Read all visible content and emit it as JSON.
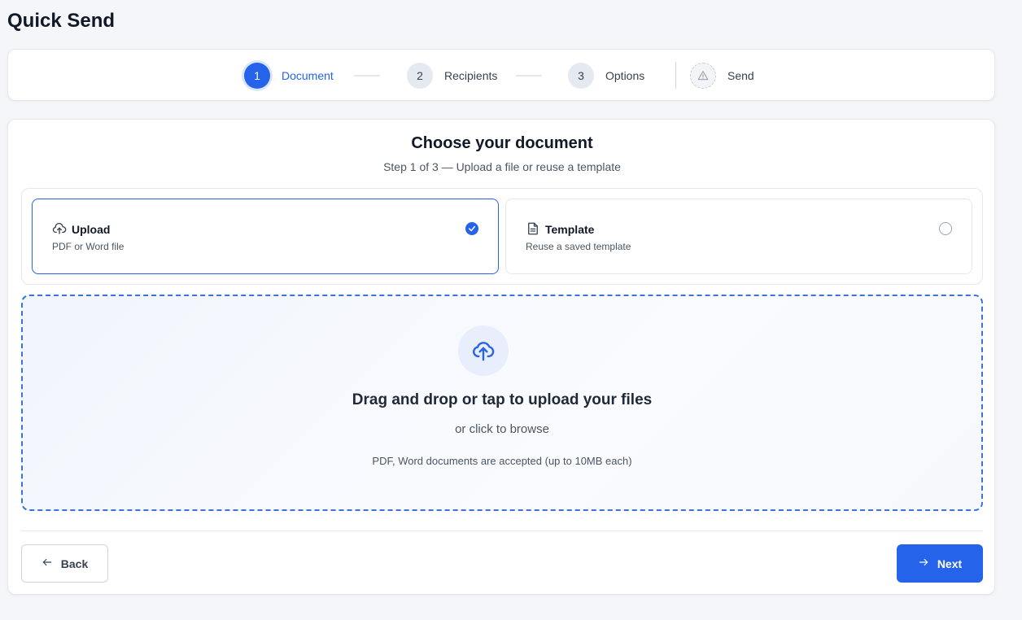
{
  "page": {
    "title": "Quick Send"
  },
  "stepper": {
    "steps": [
      {
        "number": "1",
        "label": "Document",
        "state": "active"
      },
      {
        "number": "2",
        "label": "Recipients",
        "state": "pending"
      },
      {
        "number": "3",
        "label": "Options",
        "state": "pending"
      },
      {
        "number": "",
        "label": "Send",
        "state": "pending",
        "icon": "send-warning-icon"
      }
    ]
  },
  "main": {
    "heading": "Choose your document",
    "subheading": "Step 1 of 3 — Upload a file or reuse a template",
    "options": [
      {
        "title": "Upload",
        "description": "PDF or Word file",
        "icon": "cloud-upload-icon",
        "selected": true
      },
      {
        "title": "Template",
        "description": "Reuse a saved template",
        "icon": "document-icon",
        "selected": false
      }
    ],
    "dropzone": {
      "title": "Drag and drop or tap to upload your files",
      "subtitle": "or click to browse",
      "note": "PDF, Word documents are accepted (up to 10MB each)",
      "icon": "cloud-upload-icon"
    }
  },
  "footer": {
    "back_label": "Back",
    "next_label": "Next"
  },
  "colors": {
    "accent": "#2563eb",
    "background": "#f4f6fa",
    "border": "#e5e7eb"
  }
}
